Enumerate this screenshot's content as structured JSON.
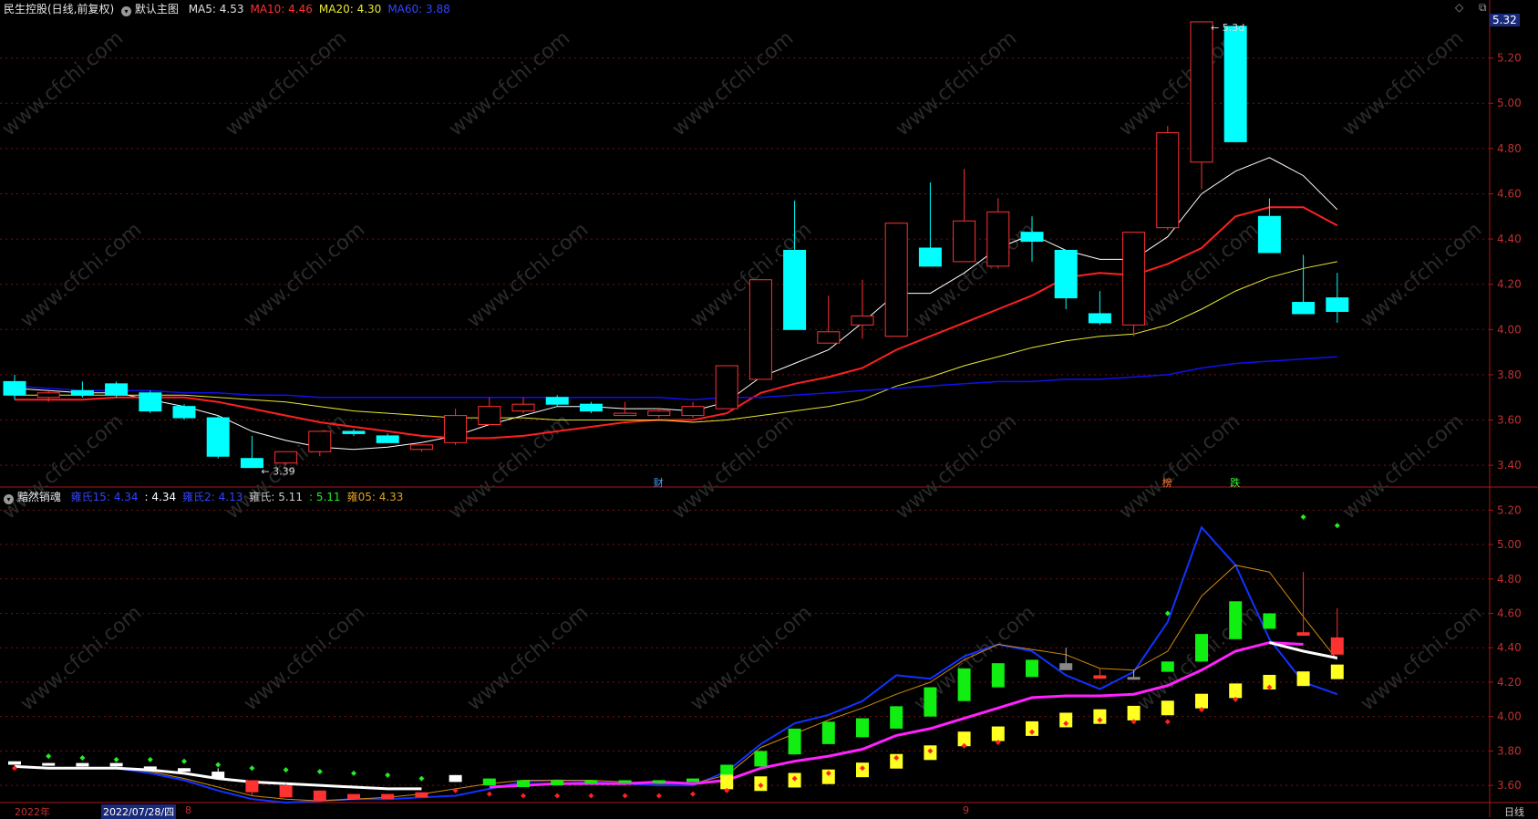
{
  "app": {
    "stock_title": "民生控股(日线,前复权)",
    "main_chart_label": "默认主图",
    "indicator_name": "黯然销魂",
    "period": "日线",
    "year_label": "2022年",
    "date_cursor": "2022/07/28/四",
    "month_marks": [
      "8",
      "9"
    ],
    "event_marks": [
      "财",
      "榜",
      "跌"
    ],
    "price_tag": "5.32"
  },
  "colors": {
    "bg": "#000000",
    "up": "#ff3232",
    "down": "#00ffff",
    "ma5": "#ffffff",
    "ma10": "#ff2020",
    "ma20": "#e8e832",
    "ma60": "#1010ee",
    "grid": "#7a1010",
    "axis_text": "#c03030",
    "green": "#11ee11",
    "magenta": "#ff22ff",
    "yellow": "#ffff22",
    "orange": "#d08a10",
    "blue": "#1133ff"
  },
  "icons": [
    "circle-chevron-down-icon",
    "diamond-icon",
    "window-restore-icon"
  ],
  "legend_main": [
    {
      "label": "MA5:",
      "value": "4.53",
      "color": "#e0e0e0"
    },
    {
      "label": "MA10:",
      "value": "4.46",
      "color": "#ff3030"
    },
    {
      "label": "MA20:",
      "value": "4.30",
      "color": "#e8e832"
    },
    {
      "label": "MA60:",
      "value": "3.88",
      "color": "#3344ff"
    }
  ],
  "legend_sub": [
    {
      "label": "雍氏15:",
      "value": "4.34",
      "color": "#3344ff"
    },
    {
      "label": ":",
      "value": "4.34",
      "color": "#ffffff"
    },
    {
      "label": "雍氏2:",
      "value": "4.13",
      "color": "#3344ff"
    },
    {
      "label": "雍氏:",
      "value": "5.11",
      "color": "#cccccc"
    },
    {
      "label": ":",
      "value": "5.11",
      "color": "#22ee22"
    },
    {
      "label": "雍05:",
      "value": "4.33",
      "color": "#e0a020"
    }
  ],
  "chart_data": [
    {
      "type": "candlestick",
      "title": "民生控股(日线,前复权)",
      "ylim": [
        3.32,
        5.4
      ],
      "y_ticks": [
        "5.20",
        "5.00",
        "4.80",
        "4.60",
        "4.40",
        "4.20",
        "4.00",
        "3.80",
        "3.60",
        "3.40"
      ],
      "annotations": {
        "high_label": "5.3d",
        "low_label": "3.39"
      },
      "candles": [
        {
          "o": 3.77,
          "h": 3.8,
          "l": 3.69,
          "c": 3.71
        },
        {
          "o": 3.7,
          "h": 3.73,
          "l": 3.68,
          "c": 3.72
        },
        {
          "o": 3.73,
          "h": 3.77,
          "l": 3.7,
          "c": 3.71
        },
        {
          "o": 3.76,
          "h": 3.77,
          "l": 3.7,
          "c": 3.71
        },
        {
          "o": 3.72,
          "h": 3.73,
          "l": 3.63,
          "c": 3.64
        },
        {
          "o": 3.66,
          "h": 3.67,
          "l": 3.6,
          "c": 3.61
        },
        {
          "o": 3.61,
          "h": 3.62,
          "l": 3.43,
          "c": 3.44
        },
        {
          "o": 3.43,
          "h": 3.53,
          "l": 3.39,
          "c": 3.39
        },
        {
          "o": 3.41,
          "h": 3.46,
          "l": 3.4,
          "c": 3.46
        },
        {
          "o": 3.46,
          "h": 3.55,
          "l": 3.44,
          "c": 3.55
        },
        {
          "o": 3.55,
          "h": 3.56,
          "l": 3.53,
          "c": 3.54
        },
        {
          "o": 3.53,
          "h": 3.54,
          "l": 3.5,
          "c": 3.5
        },
        {
          "o": 3.47,
          "h": 3.49,
          "l": 3.46,
          "c": 3.49
        },
        {
          "o": 3.5,
          "h": 3.65,
          "l": 3.49,
          "c": 3.62
        },
        {
          "o": 3.58,
          "h": 3.7,
          "l": 3.58,
          "c": 3.66
        },
        {
          "o": 3.64,
          "h": 3.7,
          "l": 3.63,
          "c": 3.67
        },
        {
          "o": 3.7,
          "h": 3.71,
          "l": 3.66,
          "c": 3.67
        },
        {
          "o": 3.67,
          "h": 3.68,
          "l": 3.63,
          "c": 3.64
        },
        {
          "o": 3.62,
          "h": 3.68,
          "l": 3.62,
          "c": 3.63
        },
        {
          "o": 3.62,
          "h": 3.65,
          "l": 3.61,
          "c": 3.64
        },
        {
          "o": 3.62,
          "h": 3.68,
          "l": 3.61,
          "c": 3.66
        },
        {
          "o": 3.65,
          "h": 3.84,
          "l": 3.65,
          "c": 3.84
        },
        {
          "o": 3.78,
          "h": 4.22,
          "l": 3.78,
          "c": 4.22
        },
        {
          "o": 4.35,
          "h": 4.57,
          "l": 4.0,
          "c": 4.0
        },
        {
          "o": 3.94,
          "h": 4.15,
          "l": 3.94,
          "c": 3.99
        },
        {
          "o": 4.02,
          "h": 4.22,
          "l": 3.96,
          "c": 4.06
        },
        {
          "o": 3.97,
          "h": 4.47,
          "l": 3.97,
          "c": 4.47
        },
        {
          "o": 4.36,
          "h": 4.65,
          "l": 4.28,
          "c": 4.28
        },
        {
          "o": 4.3,
          "h": 4.71,
          "l": 4.3,
          "c": 4.48
        },
        {
          "o": 4.28,
          "h": 4.58,
          "l": 4.27,
          "c": 4.52
        },
        {
          "o": 4.43,
          "h": 4.5,
          "l": 4.3,
          "c": 4.39
        },
        {
          "o": 4.35,
          "h": 4.35,
          "l": 4.09,
          "c": 4.14
        },
        {
          "o": 4.07,
          "h": 4.17,
          "l": 4.02,
          "c": 4.03
        },
        {
          "o": 4.02,
          "h": 4.43,
          "l": 3.97,
          "c": 4.43
        },
        {
          "o": 4.45,
          "h": 4.9,
          "l": 4.44,
          "c": 4.87
        },
        {
          "o": 4.74,
          "h": 5.36,
          "l": 4.62,
          "c": 5.36
        },
        {
          "o": 5.34,
          "h": 5.34,
          "l": 4.83,
          "c": 4.83
        },
        {
          "o": 4.5,
          "h": 4.58,
          "l": 4.34,
          "c": 4.34
        },
        {
          "o": 4.12,
          "h": 4.33,
          "l": 4.07,
          "c": 4.07
        },
        {
          "o": 4.14,
          "h": 4.25,
          "l": 4.03,
          "c": 4.08
        }
      ],
      "series": [
        {
          "name": "MA5",
          "values": [
            3.74,
            3.73,
            3.72,
            3.72,
            3.69,
            3.66,
            3.62,
            3.55,
            3.51,
            3.48,
            3.47,
            3.48,
            3.5,
            3.53,
            3.58,
            3.62,
            3.66,
            3.66,
            3.65,
            3.65,
            3.64,
            3.68,
            3.79,
            3.85,
            3.91,
            4.03,
            4.16,
            4.16,
            4.25,
            4.36,
            4.42,
            4.35,
            4.31,
            4.31,
            4.41,
            4.6,
            4.7,
            4.76,
            4.68,
            4.53
          ]
        },
        {
          "name": "MA10",
          "values": [
            3.69,
            3.69,
            3.69,
            3.7,
            3.7,
            3.7,
            3.68,
            3.65,
            3.62,
            3.59,
            3.57,
            3.55,
            3.53,
            3.52,
            3.52,
            3.53,
            3.55,
            3.57,
            3.59,
            3.6,
            3.6,
            3.63,
            3.72,
            3.76,
            3.79,
            3.83,
            3.91,
            3.97,
            4.03,
            4.09,
            4.15,
            4.23,
            4.25,
            4.24,
            4.29,
            4.36,
            4.5,
            4.54,
            4.54,
            4.46
          ]
        },
        {
          "name": "MA20",
          "values": [
            3.71,
            3.71,
            3.71,
            3.71,
            3.71,
            3.71,
            3.7,
            3.69,
            3.68,
            3.66,
            3.64,
            3.63,
            3.62,
            3.61,
            3.61,
            3.61,
            3.6,
            3.6,
            3.6,
            3.6,
            3.59,
            3.6,
            3.62,
            3.64,
            3.66,
            3.69,
            3.75,
            3.79,
            3.84,
            3.88,
            3.92,
            3.95,
            3.97,
            3.98,
            4.02,
            4.09,
            4.17,
            4.23,
            4.27,
            4.3
          ]
        },
        {
          "name": "MA60",
          "values": [
            3.75,
            3.74,
            3.73,
            3.73,
            3.73,
            3.72,
            3.72,
            3.71,
            3.71,
            3.7,
            3.7,
            3.7,
            3.7,
            3.7,
            3.7,
            3.7,
            3.7,
            3.7,
            3.7,
            3.7,
            3.69,
            3.7,
            3.7,
            3.71,
            3.72,
            3.73,
            3.74,
            3.75,
            3.76,
            3.77,
            3.77,
            3.78,
            3.78,
            3.79,
            3.8,
            3.83,
            3.85,
            3.86,
            3.87,
            3.88
          ]
        }
      ]
    },
    {
      "type": "indicator",
      "title": "黯然销魂",
      "ylim": [
        3.5,
        5.26
      ],
      "y_ticks": [
        "5.20",
        "5.00",
        "4.80",
        "4.60",
        "4.40",
        "4.20",
        "4.00",
        "3.80",
        "3.60"
      ],
      "series": [
        {
          "name": "雍氏15",
          "values": [
            3.71,
            3.7,
            3.7,
            3.7,
            3.67,
            3.63,
            3.57,
            3.52,
            3.5,
            3.51,
            3.52,
            3.52,
            3.53,
            3.54,
            3.58,
            3.62,
            3.63,
            3.62,
            3.61,
            3.6,
            3.6,
            3.68,
            3.84,
            3.96,
            4.01,
            4.09,
            4.24,
            4.22,
            4.35,
            4.42,
            4.38,
            4.24,
            4.16,
            4.26,
            4.55,
            5.1,
            4.88,
            4.45,
            4.2,
            4.13
          ]
        },
        {
          "name": "雍05",
          "values": [
            3.71,
            3.7,
            3.7,
            3.7,
            3.68,
            3.64,
            3.59,
            3.54,
            3.52,
            3.51,
            3.52,
            3.53,
            3.55,
            3.58,
            3.61,
            3.63,
            3.63,
            3.63,
            3.62,
            3.61,
            3.61,
            3.66,
            3.82,
            3.9,
            3.98,
            4.05,
            4.13,
            4.2,
            4.33,
            4.42,
            4.39,
            4.36,
            4.28,
            4.27,
            4.38,
            4.7,
            4.88,
            4.84,
            4.58,
            4.33
          ]
        },
        {
          "name": "magenta",
          "values": [
            null,
            null,
            null,
            null,
            null,
            null,
            null,
            null,
            null,
            null,
            null,
            null,
            null,
            null,
            3.59,
            3.6,
            3.61,
            3.61,
            3.61,
            3.62,
            3.61,
            3.63,
            3.7,
            3.74,
            3.77,
            3.81,
            3.89,
            3.93,
            3.99,
            4.05,
            4.11,
            4.12,
            4.12,
            4.13,
            4.18,
            4.27,
            4.38,
            4.43,
            4.42,
            null
          ]
        },
        {
          "name": "white",
          "values": [
            3.71,
            3.7,
            3.7,
            3.7,
            3.69,
            3.67,
            3.64,
            3.62,
            3.61,
            3.6,
            3.59,
            3.58,
            3.58,
            null,
            null,
            null,
            null,
            null,
            null,
            null,
            null,
            null,
            null,
            null,
            null,
            null,
            null,
            null,
            null,
            null,
            null,
            null,
            null,
            null,
            null,
            null,
            null,
            4.43,
            4.38,
            4.34
          ]
        }
      ],
      "bars": [
        {
          "o": 3.74,
          "c": 3.72,
          "h": 3.74,
          "l": 3.72
        },
        {
          "o": 3.73,
          "c": 3.72,
          "h": 3.73,
          "l": 3.72
        },
        {
          "o": 3.73,
          "c": 3.71,
          "h": 3.73,
          "l": 3.71
        },
        {
          "o": 3.73,
          "c": 3.71,
          "h": 3.73,
          "l": 3.71
        },
        {
          "o": 3.71,
          "c": 3.7,
          "h": 3.71,
          "l": 3.7
        },
        {
          "o": 3.7,
          "c": 3.68,
          "h": 3.7,
          "l": 3.68
        },
        {
          "o": 3.64,
          "c": 3.68,
          "h": 3.7,
          "l": 3.64
        },
        {
          "o": 3.56,
          "c": 3.63,
          "h": 3.63,
          "l": 3.54
        },
        {
          "o": 3.53,
          "c": 3.6,
          "h": 3.61,
          "l": 3.53
        },
        {
          "o": 3.51,
          "c": 3.57,
          "h": 3.57,
          "l": 3.51
        },
        {
          "o": 3.52,
          "c": 3.55,
          "h": 3.55,
          "l": 3.52
        },
        {
          "o": 3.52,
          "c": 3.55,
          "h": 3.55,
          "l": 3.52
        },
        {
          "o": 3.53,
          "c": 3.56,
          "h": 3.56,
          "l": 3.53
        },
        {
          "o": 3.62,
          "c": 3.66,
          "h": 3.66,
          "l": 3.62
        },
        {
          "o": 3.6,
          "c": 3.64,
          "h": 3.64,
          "l": 3.6
        },
        {
          "o": 3.59,
          "c": 3.63,
          "h": 3.63,
          "l": 3.59
        },
        {
          "o": 3.6,
          "c": 3.63,
          "h": 3.63,
          "l": 3.6
        },
        {
          "o": 3.61,
          "c": 3.63,
          "h": 3.63,
          "l": 3.61
        },
        {
          "o": 3.62,
          "c": 3.63,
          "h": 3.63,
          "l": 3.62
        },
        {
          "o": 3.62,
          "c": 3.63,
          "h": 3.63,
          "l": 3.62
        },
        {
          "o": 3.62,
          "c": 3.64,
          "h": 3.64,
          "l": 3.62
        },
        {
          "o": 3.64,
          "c": 3.72,
          "h": 3.72,
          "l": 3.64
        },
        {
          "o": 3.71,
          "c": 3.8,
          "h": 3.8,
          "l": 3.71
        },
        {
          "o": 3.78,
          "c": 3.93,
          "h": 3.93,
          "l": 3.78
        },
        {
          "o": 3.84,
          "c": 3.97,
          "h": 3.97,
          "l": 3.84
        },
        {
          "o": 3.88,
          "c": 3.99,
          "h": 3.99,
          "l": 3.88
        },
        {
          "o": 3.93,
          "c": 4.06,
          "h": 4.06,
          "l": 3.93
        },
        {
          "o": 4.0,
          "c": 4.17,
          "h": 4.17,
          "l": 4.0
        },
        {
          "o": 4.09,
          "c": 4.28,
          "h": 4.28,
          "l": 4.09
        },
        {
          "o": 4.17,
          "c": 4.31,
          "h": 4.31,
          "l": 4.17
        },
        {
          "o": 4.23,
          "c": 4.33,
          "h": 4.33,
          "l": 4.23
        },
        {
          "o": 4.27,
          "c": 4.31,
          "h": 4.4,
          "l": 4.27
        },
        {
          "o": 4.24,
          "c": 4.22,
          "h": 4.28,
          "l": 4.22
        },
        {
          "o": 4.22,
          "c": 4.23,
          "h": 4.27,
          "l": 4.22
        },
        {
          "o": 4.26,
          "c": 4.32,
          "h": 4.32,
          "l": 4.26
        },
        {
          "o": 4.32,
          "c": 4.48,
          "h": 4.48,
          "l": 4.32
        },
        {
          "o": 4.45,
          "c": 4.67,
          "h": 4.67,
          "l": 4.45
        },
        {
          "o": 4.51,
          "c": 4.6,
          "h": 4.6,
          "l": 4.51
        },
        {
          "o": 4.49,
          "c": 4.47,
          "h": 4.84,
          "l": 4.47
        },
        {
          "o": 4.46,
          "c": 4.36,
          "h": 4.63,
          "l": 4.36
        }
      ],
      "yellow_bars": [
        null,
        null,
        null,
        null,
        null,
        null,
        null,
        null,
        null,
        null,
        null,
        null,
        null,
        null,
        null,
        null,
        null,
        null,
        null,
        null,
        null,
        3.62,
        3.61,
        3.63,
        3.65,
        3.69,
        3.74,
        3.79,
        3.87,
        3.9,
        3.93,
        3.98,
        4.0,
        4.02,
        4.05,
        4.09,
        4.15,
        4.2,
        4.22,
        4.26
      ],
      "red_dots": [
        3.7,
        null,
        null,
        null,
        null,
        null,
        null,
        null,
        null,
        null,
        null,
        null,
        null,
        3.57,
        3.55,
        3.54,
        3.54,
        3.54,
        3.54,
        3.54,
        3.55,
        3.57,
        3.6,
        3.64,
        3.67,
        3.7,
        3.76,
        3.8,
        3.83,
        3.85,
        3.91,
        3.96,
        3.98,
        3.97,
        3.97,
        4.04,
        4.1,
        4.17,
        null,
        null
      ],
      "green_dots": [
        null,
        3.77,
        3.76,
        3.75,
        3.75,
        3.74,
        3.72,
        3.7,
        3.69,
        3.68,
        3.67,
        3.66,
        3.64,
        null,
        null,
        null,
        null,
        null,
        null,
        null,
        null,
        null,
        null,
        null,
        null,
        null,
        null,
        null,
        null,
        null,
        null,
        null,
        null,
        null,
        4.6,
        null,
        null,
        null,
        5.16,
        5.11
      ]
    }
  ]
}
